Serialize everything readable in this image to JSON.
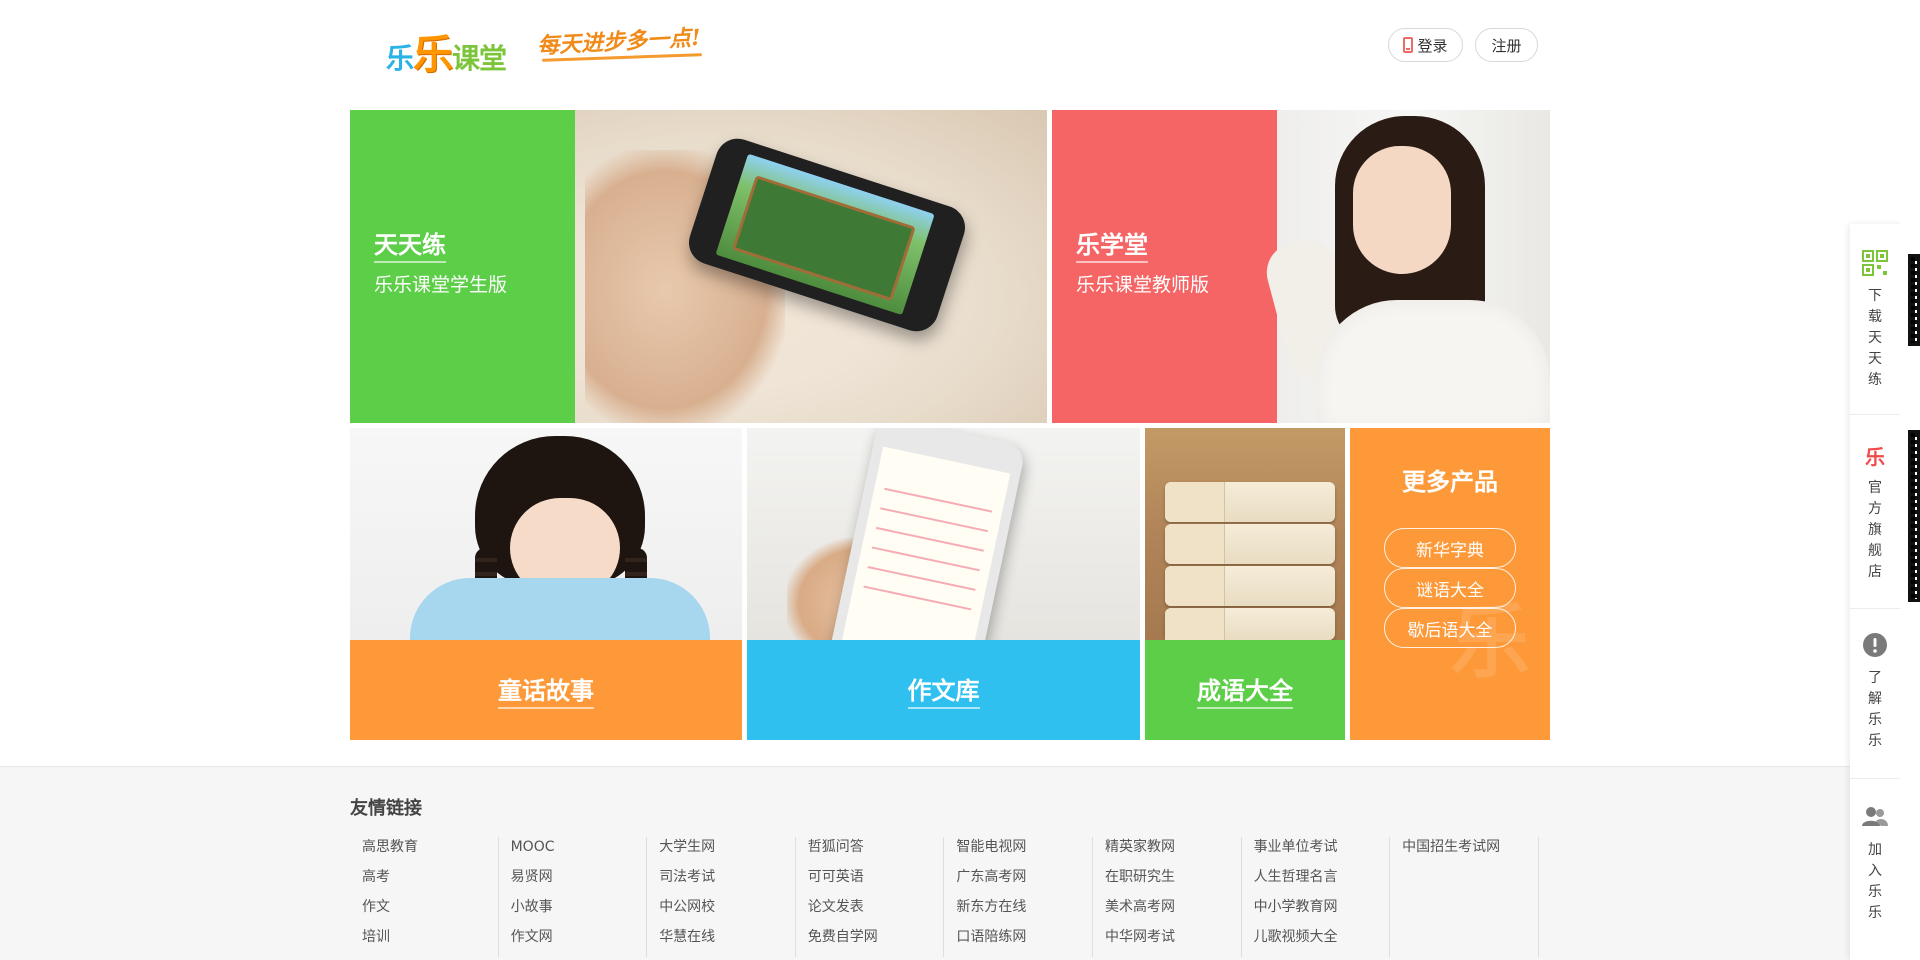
{
  "header": {
    "logo": "乐乐课堂",
    "slogan": "每天进步多一点!",
    "login_label": "登录",
    "register_label": "注册"
  },
  "tiles": {
    "tiantianlian": {
      "title": "天天练",
      "subtitle": "乐乐课堂学生版"
    },
    "lexuetang": {
      "title": "乐学堂",
      "subtitle": "乐乐课堂教师版"
    },
    "tonghua": {
      "title": "童话故事"
    },
    "zuowen": {
      "title": "作文库"
    },
    "chengyu": {
      "title": "成语大全"
    },
    "more": {
      "title": "更多产品",
      "items": [
        "新华字典",
        "谜语大全",
        "歇后语大全"
      ]
    }
  },
  "footer": {
    "title": "友情链接",
    "columns": [
      [
        "高思教育",
        "高考",
        "作文",
        "培训"
      ],
      [
        "MOOC",
        "易贤网",
        "小故事",
        "作文网"
      ],
      [
        "大学生网",
        "司法考试",
        "中公网校",
        "华慧在线"
      ],
      [
        "哲狐问答",
        "可可英语",
        "论文发表",
        "免费自学网"
      ],
      [
        "智能电视网",
        "广东高考网",
        "新东方在线",
        "口语陪练网"
      ],
      [
        "精英家教网",
        "在职研究生",
        "美术高考网",
        "中华网考试"
      ],
      [
        "事业单位考试",
        "人生哲理名言",
        "中小学教育网",
        "儿歌视频大全"
      ],
      [
        "中国招生考试网"
      ]
    ]
  },
  "sidebar": {
    "items": [
      {
        "label": "下载天天练",
        "icon": "qr-code-icon"
      },
      {
        "label": "官方旗舰店",
        "icon": "le-logo-icon"
      },
      {
        "label": "了解乐乐",
        "icon": "info-icon"
      },
      {
        "label": "加入乐乐",
        "icon": "people-icon"
      }
    ]
  },
  "colors": {
    "green": "#5cce47",
    "red": "#f56565",
    "orange": "#fd9938",
    "blue": "#2fc0f0"
  }
}
